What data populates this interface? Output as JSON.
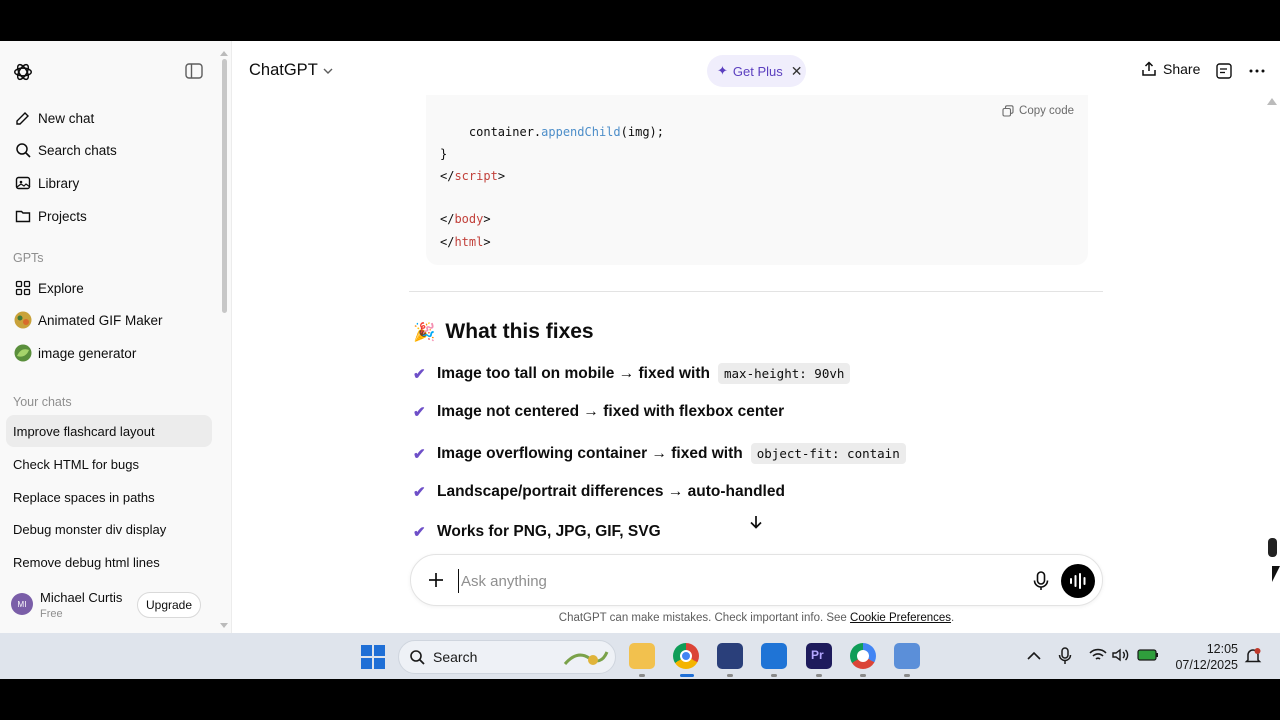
{
  "sidebar": {
    "nav": [
      {
        "label": "New chat",
        "icon": "edit-icon"
      },
      {
        "label": "Search chats",
        "icon": "search-icon"
      },
      {
        "label": "Library",
        "icon": "library-icon"
      },
      {
        "label": "Projects",
        "icon": "folder-icon"
      }
    ],
    "gpts_label": "GPTs",
    "gpts": [
      {
        "label": "Explore",
        "icon": "grid-icon"
      },
      {
        "label": "Animated GIF Maker",
        "icon": "gpt-avatar-icon"
      },
      {
        "label": "image generator",
        "icon": "gpt-avatar-icon"
      }
    ],
    "chats_label": "Your chats",
    "chats": [
      {
        "label": "Improve flashcard layout",
        "active": true
      },
      {
        "label": "Check HTML for bugs"
      },
      {
        "label": "Replace spaces in paths"
      },
      {
        "label": "Debug monster div display"
      },
      {
        "label": "Remove debug html lines"
      }
    ],
    "user": {
      "initials": "MI",
      "name": "Michael Curtis",
      "plan": "Free",
      "upgrade_label": "Upgrade"
    }
  },
  "header": {
    "model": "ChatGPT",
    "get_plus_label": "Get Plus",
    "share_label": "Share"
  },
  "code": {
    "copy_label": "Copy code",
    "lines": [
      {
        "indent": "    ",
        "obj": "container.",
        "fn": "appendChild",
        "rest": "(img);"
      },
      {
        "plain": "}"
      },
      {
        "open": "</",
        "tag": "script",
        "close": ">"
      },
      {
        "open": "</",
        "tag": "body",
        "close": ">"
      },
      {
        "open": "</",
        "tag": "html",
        "close": ">"
      }
    ]
  },
  "answer": {
    "heading_emoji": "🎉",
    "heading": "What this fixes",
    "items": [
      {
        "text": "Image too tall on mobile → fixed with",
        "code": "max-height: 90vh"
      },
      {
        "text": "Image not centered → fixed with flexbox center",
        "code": ""
      },
      {
        "text": "Image overflowing container → fixed with",
        "code": "object-fit: contain"
      },
      {
        "text": "Landscape/portrait differences → auto-handled",
        "code": ""
      },
      {
        "text": "Works for PNG, JPG, GIF, SVG",
        "code": ""
      }
    ],
    "check_glyph": "✔"
  },
  "composer": {
    "placeholder": "Ask anything"
  },
  "disclaimer": {
    "text": "ChatGPT can make mistakes. Check important info. See ",
    "link": "Cookie Preferences",
    "end": "."
  },
  "taskbar": {
    "search_label": "Search",
    "time": "12:05",
    "date": "07/12/2025"
  },
  "colors": {
    "accent": "#6e4fc8",
    "code_tag": "#c2413b",
    "code_fn": "#4d8ec9"
  }
}
